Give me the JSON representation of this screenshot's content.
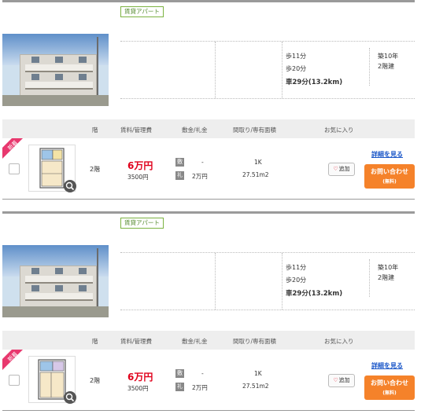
{
  "listings": [
    {
      "badge": "賃貸アパート",
      "access": [
        "歩11分",
        "歩20分",
        "車29分(13.2km)"
      ],
      "built": [
        "築10年",
        "2階建"
      ],
      "table_headers": [
        "階",
        "賃料/管理費",
        "敷金/礼金",
        "間取り/専有面積",
        "お気に入り"
      ],
      "rooms": [
        {
          "new_label": "新着",
          "floor": "2階",
          "rent": "6万円",
          "mgmt_fee": "3500円",
          "deposit_label": "敷",
          "deposit_value": "-",
          "key_money_label": "礼",
          "key_money_value": "2万円",
          "layout": "1K",
          "area": "27.51m2",
          "fav_label": "追加",
          "detail_label": "詳細を見る",
          "inquiry_label": "お問い合わせ",
          "inquiry_sub": "(無料)"
        }
      ]
    },
    {
      "badge": "賃貸アパート",
      "access": [
        "歩11分",
        "歩20分",
        "車29分(13.2km)"
      ],
      "built": [
        "築10年",
        "2階建"
      ],
      "table_headers": [
        "階",
        "賃料/管理費",
        "敷金/礼金",
        "間取り/専有面積",
        "お気に入り"
      ],
      "rooms": [
        {
          "new_label": "新着",
          "floor": "2階",
          "rent": "6万円",
          "mgmt_fee": "3500円",
          "deposit_label": "敷",
          "deposit_value": "-",
          "key_money_label": "礼",
          "key_money_value": "2万円",
          "layout": "1K",
          "area": "27.51m2",
          "fav_label": "追加",
          "detail_label": "詳細を見る",
          "inquiry_label": "お問い合わせ",
          "inquiry_sub": "(無料)"
        }
      ]
    }
  ],
  "colors": {
    "price": "#e0001b",
    "badge_border": "#7cb342",
    "inquiry_button": "#f5822a",
    "link": "#1a56c8",
    "new_ribbon": "#e8386e"
  }
}
